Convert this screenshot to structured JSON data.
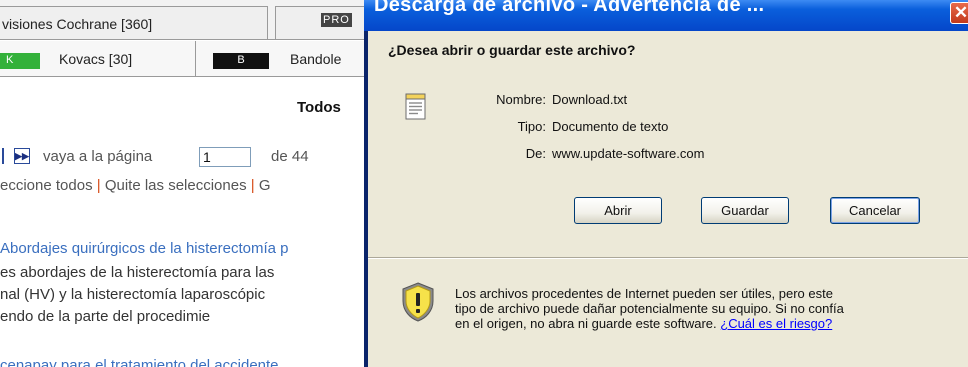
{
  "background_page": {
    "tabs_row1": {
      "tab1_label": "visiones Cochrane [360]",
      "pro_badge": "PRO"
    },
    "tabs_row2": {
      "k_badge": "K",
      "kovacs_label": "Kovacs [30]",
      "b_badge": "B",
      "bandole_label": "Bandole"
    },
    "todos_heading": "Todos",
    "pager": {
      "goto_label": "vaya a la página",
      "page_value": "1",
      "of_label": "de 44"
    },
    "selection": {
      "select_all": "eccione todos",
      "sep1": "|",
      "clear": "Quite las selecciones",
      "sep2": "|",
      "trailing": "G"
    },
    "result": {
      "title": "Abordajes quirúrgicos de la histerectomía p",
      "line1": "es abordajes de la histerectomía para las",
      "line2": "nal (HV) y la histerectomía laparoscópic",
      "line3": "endo de la parte del procedimie",
      "next_title": "cenapay para el tratamiento del accidente"
    }
  },
  "dialog": {
    "title": "Descarga de archivo - Advertencia de ...",
    "close_glyph": "✕",
    "question": "¿Desea abrir o guardar este archivo?",
    "name_label": "Nombre:",
    "name_value": "Download.txt",
    "type_label": "Tipo:",
    "type_value": "Documento de texto",
    "from_label": "De:",
    "from_value": "www.update-software.com",
    "buttons": {
      "open": "Abrir",
      "save": "Guardar",
      "cancel": "Cancelar"
    },
    "warning_line1": "Los archivos procedentes de Internet pueden ser útiles, pero este",
    "warning_line2": "tipo de archivo puede dañar potencialmente su equipo. Si no confía",
    "warning_line3": "en el origen, no abra ni guarde este software.",
    "risk_link": "¿Cuál es el riesgo?"
  },
  "icons": {
    "file": "text-file-icon",
    "shield": "security-shield-icon",
    "pager_next": "next-page-icon"
  },
  "colors": {
    "titlebar": "#0a5fdc",
    "dialog_bg": "#ece9d8",
    "link": "#0000ff",
    "result_link": "#3a6fbf",
    "separator_bar": "#d64d1a",
    "k_badge": "#33b13a"
  }
}
